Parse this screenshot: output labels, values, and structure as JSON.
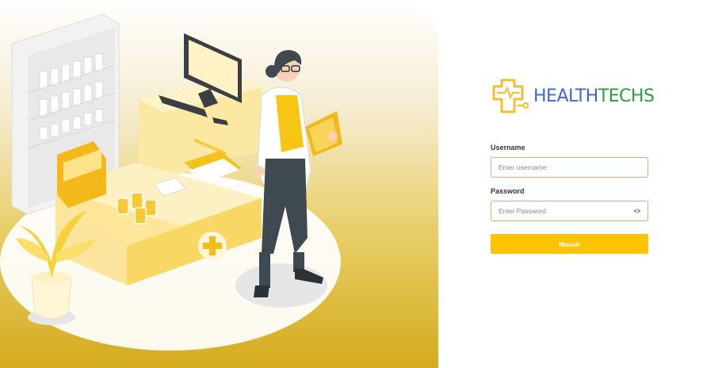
{
  "brand": {
    "part1": "HEALTH",
    "part2": "TECHS",
    "color1": "#3d66d9",
    "color2": "#2e9a41",
    "icon_color": "#f5bf2a"
  },
  "form": {
    "username_label": "Username",
    "username_placeholder": "Enter username",
    "password_label": "Password",
    "password_placeholder": "Enter Password",
    "submit_label": "Masuk",
    "accent": "#ffc400"
  },
  "illustration": {
    "description_icon": "pharmacist-illustration"
  }
}
